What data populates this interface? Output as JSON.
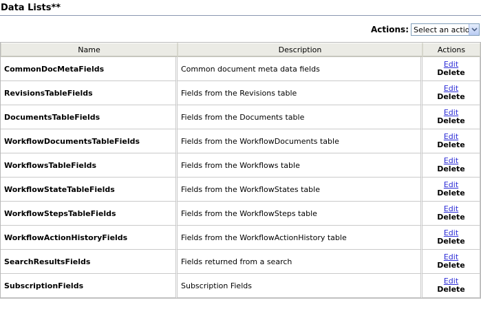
{
  "page": {
    "title": "Data Lists**"
  },
  "actions": {
    "label": "Actions:",
    "select_value": "Select an action"
  },
  "table": {
    "headers": {
      "name": "Name",
      "description": "Description",
      "actions": "Actions"
    },
    "edit_label": "Edit",
    "delete_label": "Delete",
    "rows": [
      {
        "name": "CommonDocMetaFields",
        "description": "Common document meta data fields"
      },
      {
        "name": "RevisionsTableFields",
        "description": "Fields from the Revisions table"
      },
      {
        "name": "DocumentsTableFields",
        "description": "Fields from the Documents table"
      },
      {
        "name": "WorkflowDocumentsTableFields",
        "description": "Fields from the WorkflowDocuments table"
      },
      {
        "name": "WorkflowsTableFields",
        "description": "Fields from the Workflows table"
      },
      {
        "name": "WorkflowStateTableFields",
        "description": "Fields from the WorkflowStates table"
      },
      {
        "name": "WorkflowStepsTableFields",
        "description": "Fields from the WorkflowSteps table"
      },
      {
        "name": "WorkflowActionHistoryFields",
        "description": "Fields from the WorkflowActionHistory table"
      },
      {
        "name": "SearchResultsFields",
        "description": "Fields returned from a search"
      },
      {
        "name": "SubscriptionFields",
        "description": "Subscription Fields"
      }
    ]
  }
}
